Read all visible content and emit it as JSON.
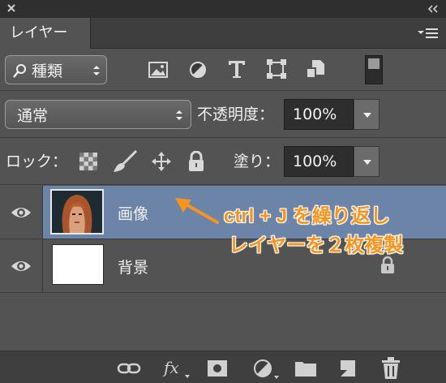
{
  "panel": {
    "tab_label": "レイヤー"
  },
  "filter": {
    "selected": "種類",
    "icons": [
      "image-filter-icon",
      "adjustment-filter-icon",
      "type-filter-icon",
      "shape-filter-icon",
      "smart-object-filter-icon",
      "filter-toggle-icon"
    ]
  },
  "blend": {
    "mode": "通常",
    "opacity_label": "不透明度：",
    "opacity_value": "100%"
  },
  "lock": {
    "label": "ロック：",
    "fill_label": "塗り：",
    "fill_value": "100%"
  },
  "layers": [
    {
      "name": "画像",
      "selected": true,
      "visible": true
    },
    {
      "name": "背景",
      "selected": false,
      "visible": true,
      "locked": true
    }
  ],
  "annotation": {
    "line1": "ctrl + J を繰り返し",
    "line2": "レイヤーを２枚複製",
    "color": "#f7941d"
  },
  "colors": {
    "panel_bg": "#535353",
    "selected_layer": "#6c84a8",
    "header_bg": "#2f2f2f"
  }
}
